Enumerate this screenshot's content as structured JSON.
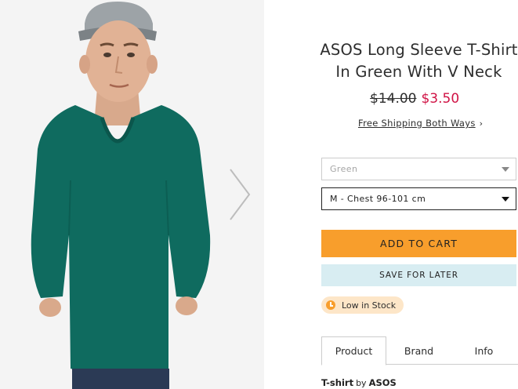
{
  "product": {
    "title_line1": "ASOS Long Sleeve T-Shirt",
    "title_line2": "In Green With V Neck",
    "price_old": "$14.00",
    "price_new": "$3.50",
    "shipping_label": "Free Shipping Both Ways",
    "shipping_chevron": "›"
  },
  "options": {
    "colour_placeholder": "Green",
    "size_selected": "M - Chest 96-101 cm"
  },
  "actions": {
    "add_to_cart": "ADD TO CART",
    "save_for_later": "SAVE FOR LATER"
  },
  "stock": {
    "label": "Low in Stock",
    "icon": "clock-icon"
  },
  "tabs": [
    {
      "label": "Product",
      "active": true
    },
    {
      "label": "Brand",
      "active": false
    },
    {
      "label": "Info",
      "active": false
    }
  ],
  "description": {
    "type": "T-shirt",
    "by": "by",
    "brand": "ASOS"
  },
  "colors": {
    "shirt": "#0f6b5f",
    "cart_button": "#f89e2c",
    "save_button": "#d8edf2",
    "sale_price": "#d01345",
    "stock_badge": "#fde6c8"
  },
  "image": {
    "next_icon": "chevron-right-icon"
  }
}
